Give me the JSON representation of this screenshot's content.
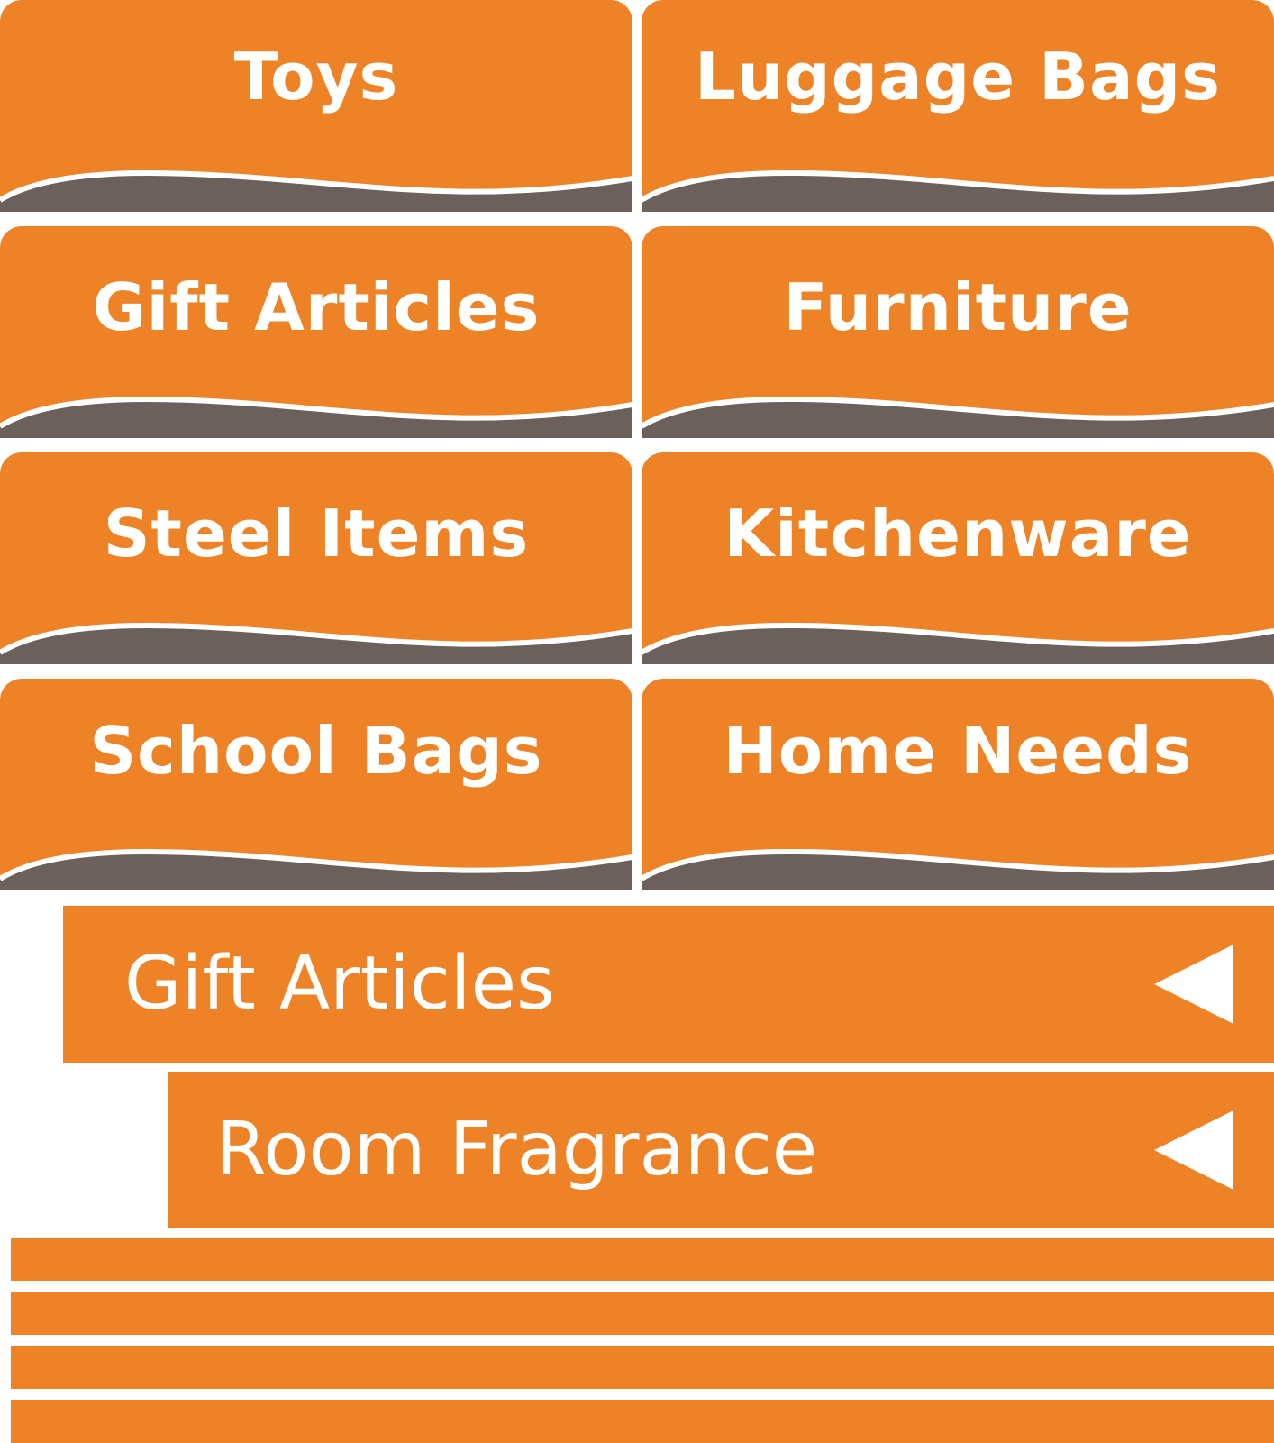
{
  "colors": {
    "accent_orange": "#ee8226",
    "wave_gray": "#6b605b",
    "text_white": "#ffffff"
  },
  "categories": [
    {
      "label": "Toys"
    },
    {
      "label": "Luggage Bags"
    },
    {
      "label": "Gift Articles"
    },
    {
      "label": "Furniture"
    },
    {
      "label": "Steel Items"
    },
    {
      "label": "Kitchenware"
    },
    {
      "label": "School Bags"
    },
    {
      "label": "Home Needs"
    }
  ],
  "submenu": [
    {
      "label": "Gift Articles",
      "icon": "triangle-left-icon"
    },
    {
      "label": "Room Fragrance",
      "icon": "triangle-left-icon"
    }
  ]
}
